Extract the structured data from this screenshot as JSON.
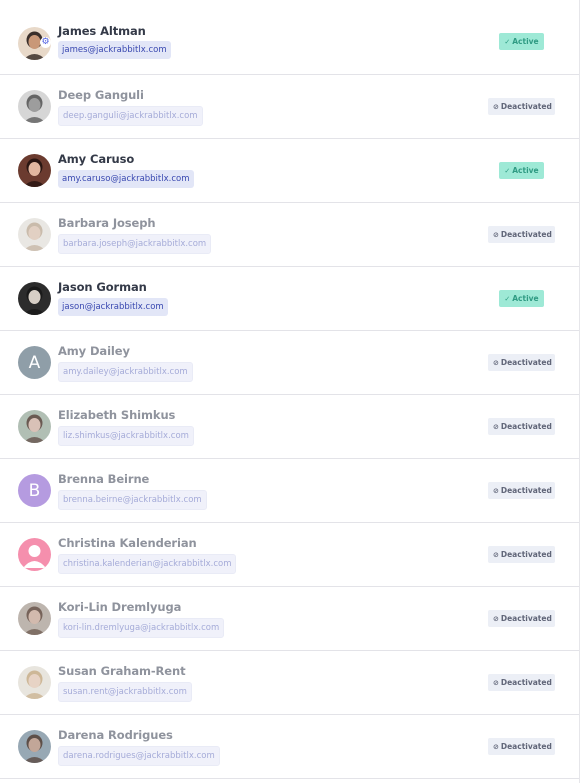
{
  "users": [
    {
      "name": "James Altman",
      "email": "james@jackrabbitlx.com",
      "status": "Active",
      "state": "active",
      "avatar": "photo-bald-beard",
      "admin": true
    },
    {
      "name": "Deep Ganguli",
      "email": "deep.ganguli@jackrabbitlx.com",
      "status": "Deactivated",
      "state": "inactive",
      "avatar": "photo-grayscale"
    },
    {
      "name": "Amy Caruso",
      "email": "amy.caruso@jackrabbitlx.com",
      "status": "Active",
      "state": "active",
      "avatar": "photo-dark-hair"
    },
    {
      "name": "Barbara Joseph",
      "email": "barbara.joseph@jackrabbitlx.com",
      "status": "Deactivated",
      "state": "inactive",
      "avatar": "photo-light-hair"
    },
    {
      "name": "Jason Gorman",
      "email": "jason@jackrabbitlx.com",
      "status": "Active",
      "state": "active",
      "avatar": "photo-glasses"
    },
    {
      "name": "Amy Dailey",
      "email": "amy.dailey@jackrabbitlx.com",
      "status": "Deactivated",
      "state": "inactive",
      "avatar": "letter",
      "initial": "A",
      "color": "#8f9ea8"
    },
    {
      "name": "Elizabeth Shimkus",
      "email": "liz.shimkus@jackrabbitlx.com",
      "status": "Deactivated",
      "state": "inactive",
      "avatar": "photo-outdoor"
    },
    {
      "name": "Brenna Beirne",
      "email": "brenna.beirne@jackrabbitlx.com",
      "status": "Deactivated",
      "state": "inactive",
      "avatar": "letter",
      "initial": "B",
      "color": "#b59be0"
    },
    {
      "name": "Christina Kalenderian",
      "email": "christina.kalenderian@jackrabbitlx.com",
      "status": "Deactivated",
      "state": "inactive",
      "avatar": "person-placeholder",
      "color": "#f58fad"
    },
    {
      "name": "Kori-Lin Dremlyuga",
      "email": "kori-lin.dremlyuga@jackrabbitlx.com",
      "status": "Deactivated",
      "state": "inactive",
      "avatar": "photo-brown-hair"
    },
    {
      "name": "Susan Graham-Rent",
      "email": "susan.rent@jackrabbitlx.com",
      "status": "Deactivated",
      "state": "inactive",
      "avatar": "photo-blonde"
    },
    {
      "name": "Darena Rodrigues",
      "email": "darena.rodrigues@jackrabbitlx.com",
      "status": "Deactivated",
      "state": "inactive",
      "avatar": "photo-smiling"
    }
  ],
  "icons": {
    "active": "check-icon",
    "deactivated": "ban-icon",
    "admin": "gear-icon"
  },
  "colors": {
    "active_badge": "#9ee9d6",
    "deactivated_badge": "#eceff6",
    "email_chip": "#e2e6f7"
  }
}
